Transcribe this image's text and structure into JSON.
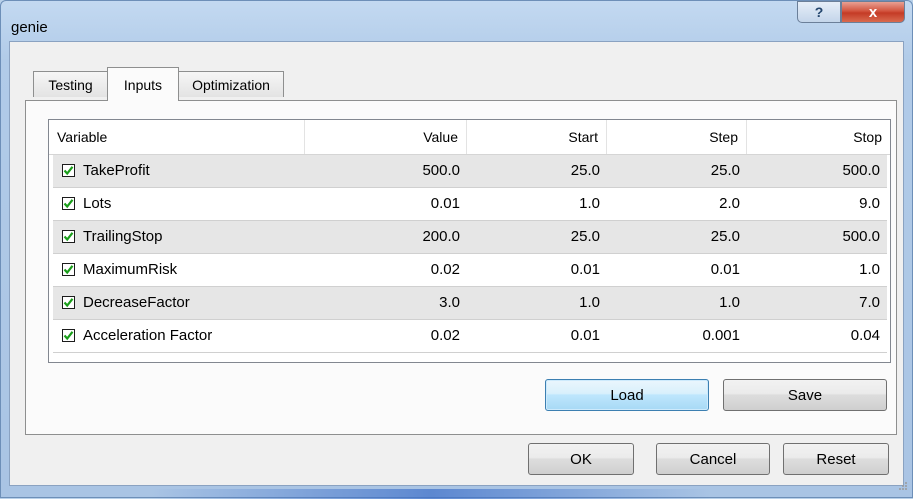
{
  "window": {
    "title": "genie",
    "help_label": "?",
    "close_label": "x"
  },
  "tabs": [
    {
      "label": "Testing",
      "active": false
    },
    {
      "label": "Inputs",
      "active": true
    },
    {
      "label": "Optimization",
      "active": false
    }
  ],
  "grid": {
    "columns": [
      "Variable",
      "Value",
      "Start",
      "Step",
      "Stop"
    ],
    "rows": [
      {
        "checked": true,
        "name": "TakeProfit",
        "value": "500.0",
        "start": "25.0",
        "step": "25.0",
        "stop": "500.0"
      },
      {
        "checked": true,
        "name": "Lots",
        "value": "0.01",
        "start": "1.0",
        "step": "2.0",
        "stop": "9.0"
      },
      {
        "checked": true,
        "name": "TrailingStop",
        "value": "200.0",
        "start": "25.0",
        "step": "25.0",
        "stop": "500.0"
      },
      {
        "checked": true,
        "name": "MaximumRisk",
        "value": "0.02",
        "start": "0.01",
        "step": "0.01",
        "stop": "1.0"
      },
      {
        "checked": true,
        "name": "DecreaseFactor",
        "value": "3.0",
        "start": "1.0",
        "step": "1.0",
        "stop": "7.0"
      },
      {
        "checked": true,
        "name": "Acceleration Factor",
        "value": "0.02",
        "start": "0.01",
        "step": "0.001",
        "stop": "0.04"
      }
    ]
  },
  "buttons": {
    "load": "Load",
    "save": "Save",
    "ok": "OK",
    "cancel": "Cancel",
    "reset": "Reset"
  },
  "colors": {
    "checkmark": "#1a9e1a",
    "close_button": "#c43b26",
    "default_button_border": "#3c7fb1"
  }
}
